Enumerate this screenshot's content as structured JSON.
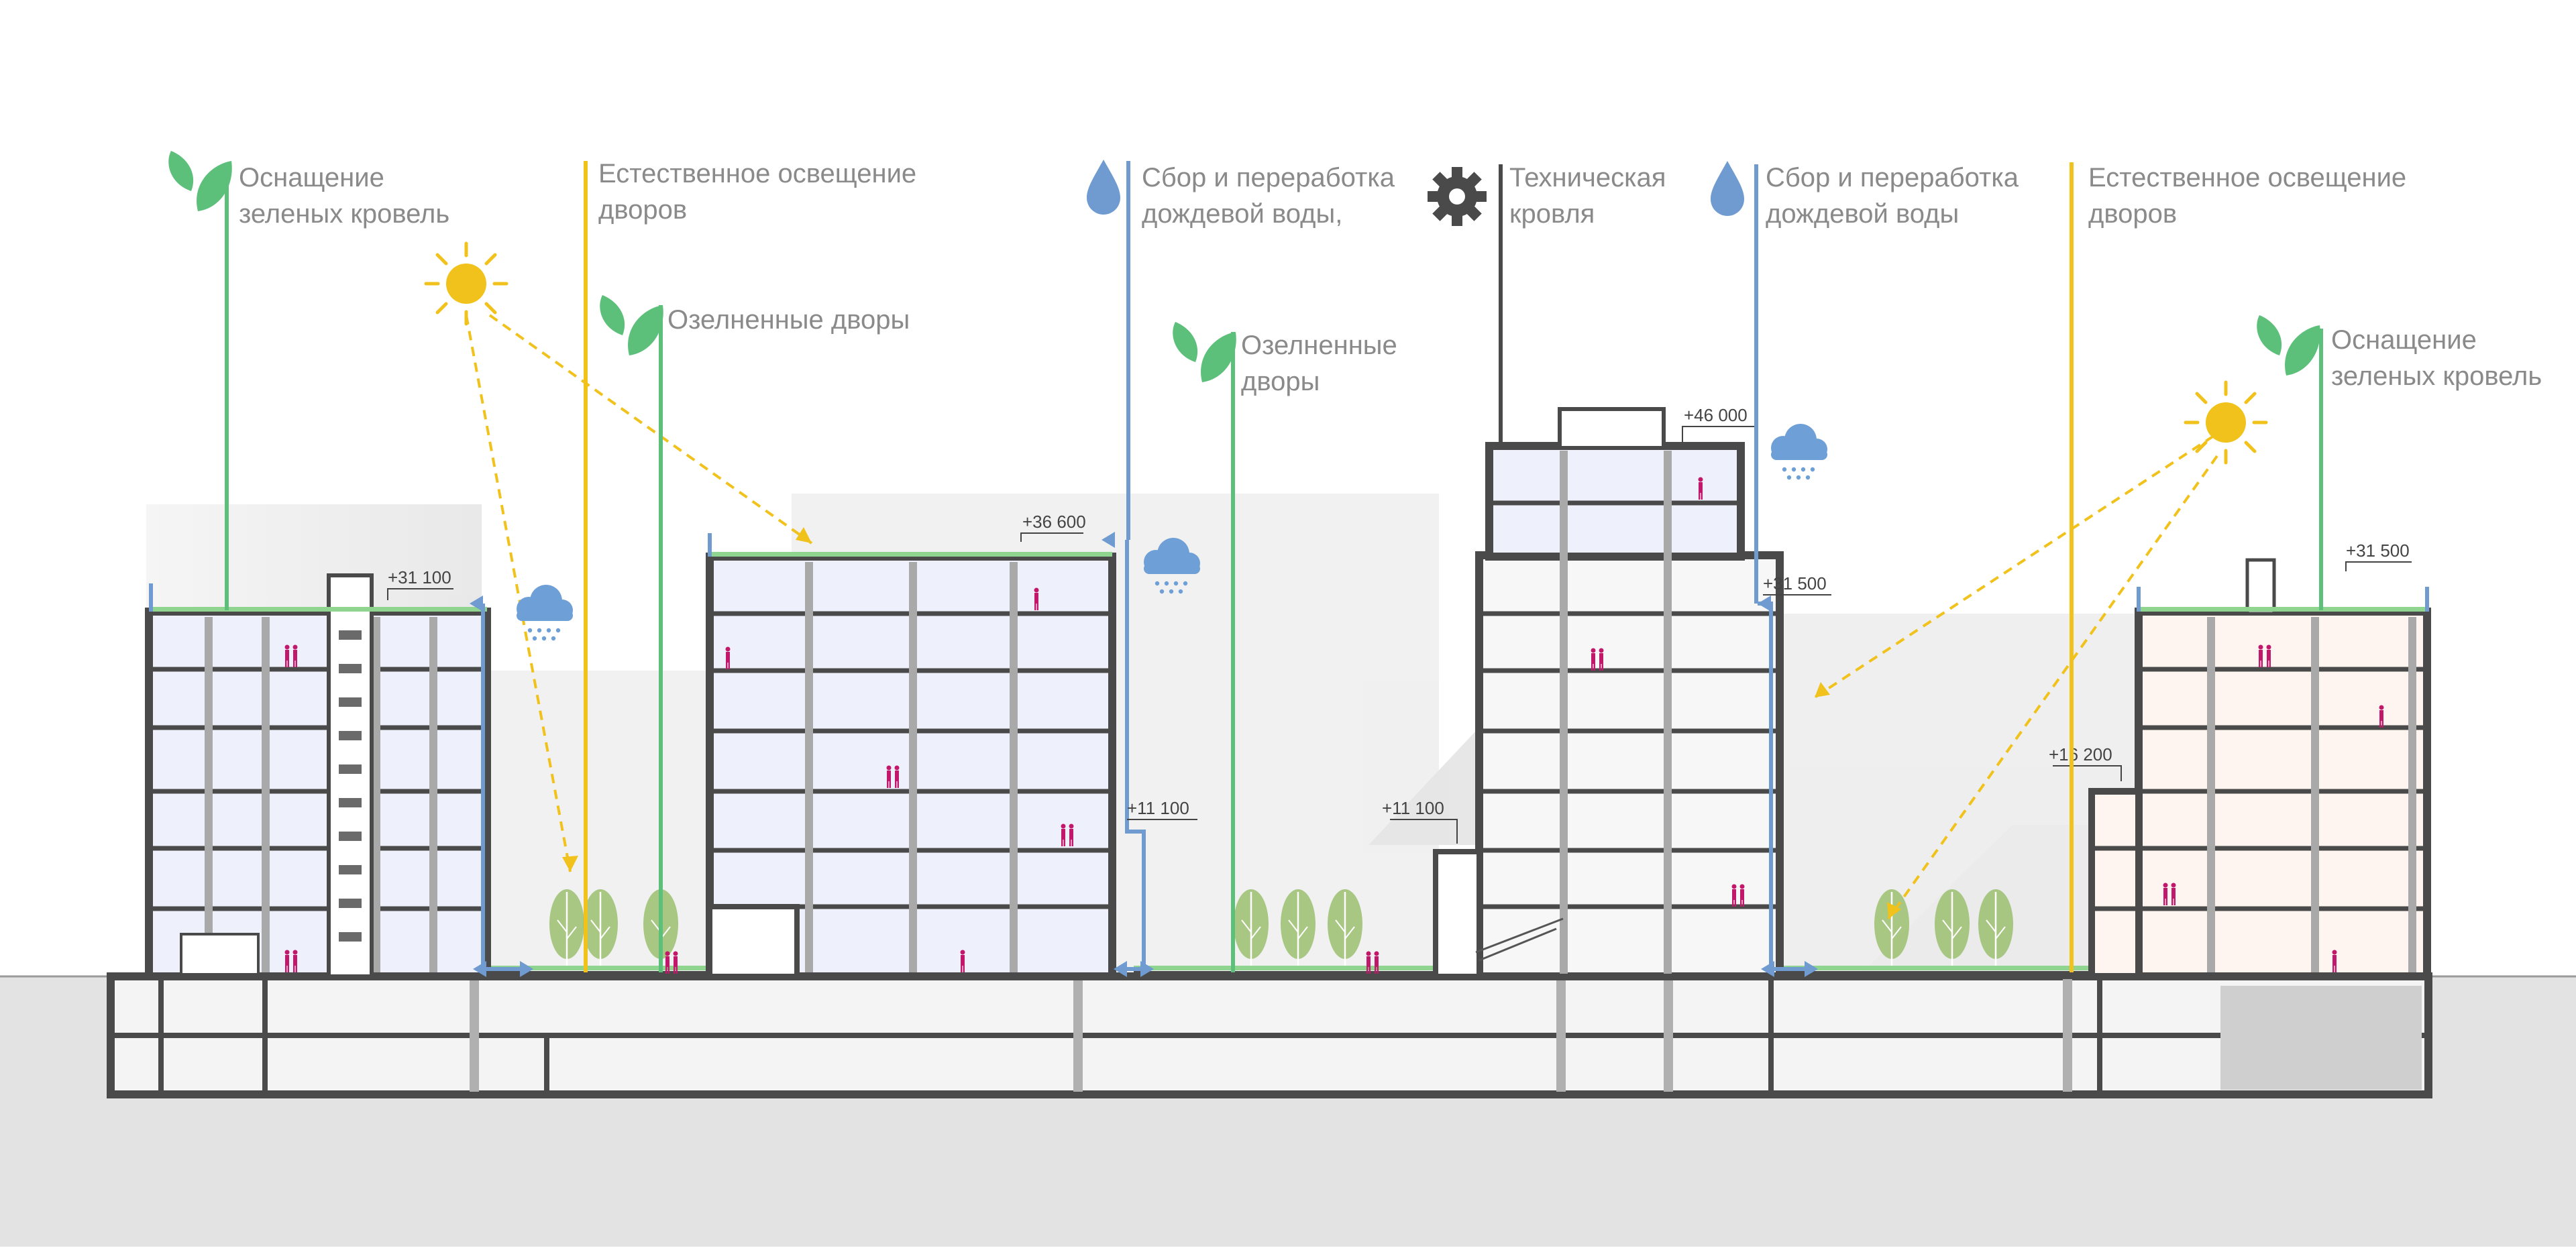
{
  "colors": {
    "green": "#5cc07a",
    "yellow": "#f0c21b",
    "blue": "#6f9bd1",
    "dark": "#4a4a4a",
    "rain": "#6e9fd6",
    "person": "#c2186b",
    "ground": "#e3e3e3"
  },
  "icons": {
    "green": "leaf-icon",
    "yellow": "sun-icon",
    "blue": "water-drop-icon",
    "dark": "gear-icon"
  },
  "labels": [
    {
      "lines": [
        "Оснащение",
        "зеленых кровель"
      ],
      "icon": "leaf-icon"
    },
    {
      "lines": [
        "Естественное освещение",
        "дворов"
      ],
      "icon": "none"
    },
    {
      "lines": [
        "Озелненные дворы"
      ],
      "icon": "leaf-icon"
    },
    {
      "lines": [
        "Сбор и переработка",
        "дождевой воды,"
      ],
      "icon": "water-drop-icon"
    },
    {
      "lines": [
        "Озелненные",
        "дворы"
      ],
      "icon": "leaf-icon"
    },
    {
      "lines": [
        "Техническая",
        "кровля"
      ],
      "icon": "gear-icon"
    },
    {
      "lines": [
        "Сбор и переработка",
        "дождевой воды"
      ],
      "icon": "water-drop-icon"
    },
    {
      "lines": [
        "Естественное освещение",
        "дворов"
      ],
      "icon": "none"
    },
    {
      "lines": [
        "Оснащение",
        "зеленых кровель"
      ],
      "icon": "leaf-icon"
    }
  ],
  "elevations": [
    "+31 100",
    "+36 600",
    "+11 100",
    "+11 100",
    "+46 000",
    "+31 500",
    "+16 200",
    "+31 500"
  ]
}
